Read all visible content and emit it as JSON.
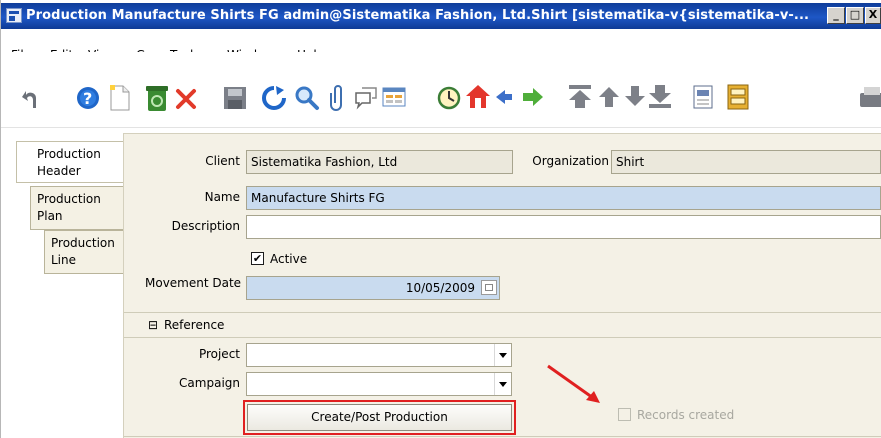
{
  "window": {
    "title": "Production  Manufacture Shirts FG  admin@Sistematika Fashion, Ltd.Shirt [sistematika-v{sistematika-v-...",
    "controls": [
      "_",
      "□",
      "X"
    ]
  },
  "menu": [
    {
      "label": "File",
      "mnemonic_index": 0
    },
    {
      "label": "Edit",
      "mnemonic_index": 0
    },
    {
      "label": "View",
      "mnemonic_index": 0
    },
    {
      "label": "Go",
      "mnemonic_index": 0
    },
    {
      "label": "Tools",
      "mnemonic_index": 0
    },
    {
      "label": "Window",
      "mnemonic_index": 0
    },
    {
      "label": "Help",
      "mnemonic_index": 0
    }
  ],
  "toolbar": [
    "undo",
    "help",
    "new-record",
    "delete",
    "delete-selected",
    "save",
    "refresh",
    "find",
    "attachment",
    "chat",
    "grid-toggle",
    "history",
    "home",
    "back",
    "forward",
    "first-record",
    "previous-record",
    "next-record",
    "last-record",
    "report",
    "archive",
    "print"
  ],
  "tabs": [
    "Production Header",
    "Production Plan",
    "Production Line"
  ],
  "form": {
    "client_label": "Client",
    "client_value": "Sistematika Fashion, Ltd",
    "org_label": "Organization",
    "org_value": "Shirt",
    "name_label": "Name",
    "name_value": "Manufacture Shirts FG",
    "description_label": "Description",
    "description_value": "",
    "active_label": "Active",
    "active_checked": "✔",
    "movement_date_label": "Movement Date",
    "movement_date_value": "10/05/2009",
    "reference_section": "Reference",
    "reference_toggle": "⊟",
    "project_label": "Project",
    "project_value": "",
    "campaign_label": "Campaign",
    "campaign_value": "",
    "create_button": "Create/Post Production",
    "records_created_label": "Records created"
  },
  "colors": {
    "title_bar": "#1e57c6",
    "form_bg": "#f4f1e6",
    "highlight_red": "#e02020",
    "mandatory_field": "#c9dbef"
  }
}
